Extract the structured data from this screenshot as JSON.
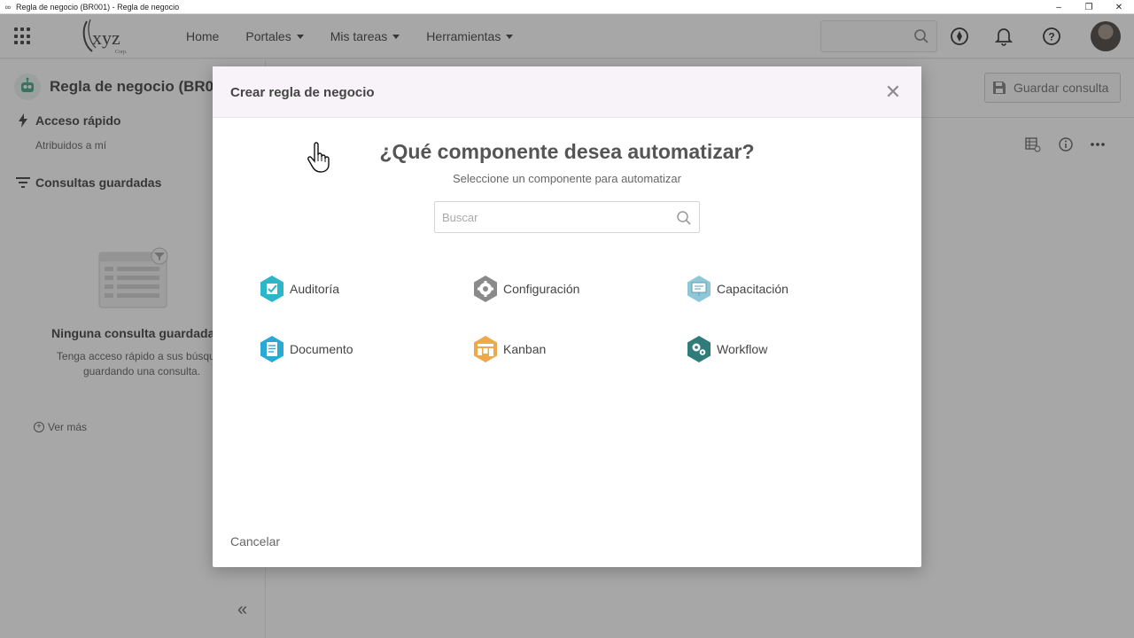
{
  "window": {
    "title": "Regla de negocio (BR001) - Regla de negocio",
    "controls": [
      "–",
      "❐",
      "✕"
    ]
  },
  "header": {
    "logo_text": "xyz",
    "logo_sub": "Corp.",
    "nav": [
      {
        "label": "Home",
        "has_caret": false
      },
      {
        "label": "Portales",
        "has_caret": true
      },
      {
        "label": "Mis tareas",
        "has_caret": true
      },
      {
        "label": "Herramientas",
        "has_caret": true
      }
    ],
    "search_placeholder": "",
    "icons": [
      "compass-icon",
      "bell-icon",
      "help-icon"
    ]
  },
  "sidebar": {
    "title": "Regla de negocio (BR00",
    "quick_access": "Acceso rápido",
    "assigned": "Atribuidos a mí",
    "saved_queries": "Consultas guardadas",
    "empty_title": "Ninguna consulta guardada",
    "empty_desc": "Tenga acceso rápido a sus búsqued guardando una consulta.",
    "see_more": "Ver más",
    "collapse": "«"
  },
  "content": {
    "save_query": "Guardar consulta"
  },
  "modal": {
    "title": "Crear regla de negocio",
    "close": "✕",
    "question": "¿Qué componente desea automatizar?",
    "subtitle": "Seleccione un componente para automatizar",
    "search_placeholder": "Buscar",
    "components": [
      {
        "label": "Auditoría",
        "icon": "audit-icon",
        "color": "#2bb7c7"
      },
      {
        "label": "Configuración",
        "icon": "gear-icon",
        "color": "#8a8a8a"
      },
      {
        "label": "Capacitación",
        "icon": "training-icon",
        "color": "#8fc7d8"
      },
      {
        "label": "Documento",
        "icon": "document-icon",
        "color": "#29a9d4"
      },
      {
        "label": "Kanban",
        "icon": "kanban-icon",
        "color": "#f0a94a"
      },
      {
        "label": "Workflow",
        "icon": "workflow-icon",
        "color": "#2f7c7a"
      }
    ],
    "cancel": "Cancelar"
  },
  "colors": {
    "overlay": "rgba(60,60,60,0.45)",
    "modal_header_bg": "#f7f3f8",
    "text_primary": "#333333"
  }
}
